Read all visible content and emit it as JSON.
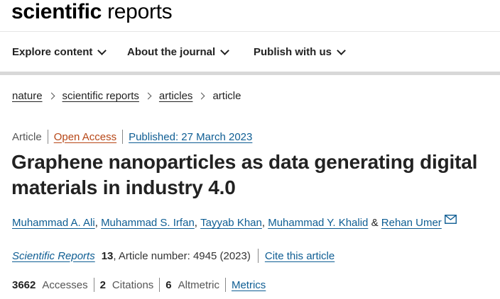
{
  "header": {
    "logo_bold": "scientific",
    "logo_light": "reports"
  },
  "nav": {
    "items": [
      {
        "label": "Explore content"
      },
      {
        "label": "About the journal"
      },
      {
        "label": "Publish with us"
      }
    ]
  },
  "breadcrumb": [
    "nature",
    "scientific reports",
    "articles",
    "article"
  ],
  "article": {
    "type": "Article",
    "access": "Open Access",
    "published": "Published: 27 March 2023",
    "title": "Graphene nanoparticles as data generating digital materials in industry 4.0",
    "authors": [
      "Muhammad A. Ali",
      "Muhammad S. Irfan",
      "Tayyab Khan",
      "Muhammad Y. Khalid",
      "Rehan Umer"
    ],
    "author_separators": [
      ",",
      ",",
      ",",
      "&"
    ],
    "journal": "Scientific Reports",
    "volume": "13",
    "article_number": ", Article number: 4945 (2023)",
    "cite_label": "Cite this article"
  },
  "metrics": {
    "accesses_value": "3662",
    "accesses_label": "Accesses",
    "citations_value": "2",
    "citations_label": "Citations",
    "altmetric_value": "6",
    "altmetric_label": "Altmetric",
    "metrics_link": "Metrics"
  },
  "icons": {
    "nav_chevron": "chevron-down-icon",
    "breadcrumb_separator": "chevron-right-icon",
    "corresponding_author": "envelope-icon"
  },
  "colors": {
    "link": "#0e5d93",
    "open_access": "#b74616",
    "text": "#222222"
  }
}
